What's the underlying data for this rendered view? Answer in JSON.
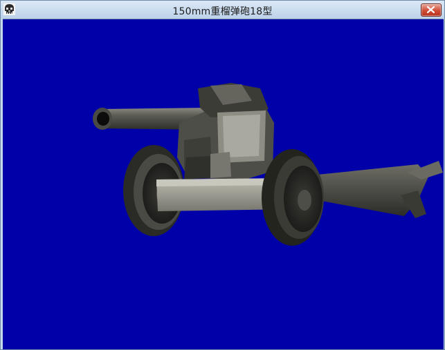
{
  "window": {
    "title": "150mm重榴弹砲18型",
    "close_label": "×"
  },
  "icons": {
    "app": "skull-app-icon",
    "close": "close-icon"
  },
  "viewport": {
    "background_color": "#0000A8",
    "subject": "artillery-gun-model"
  }
}
